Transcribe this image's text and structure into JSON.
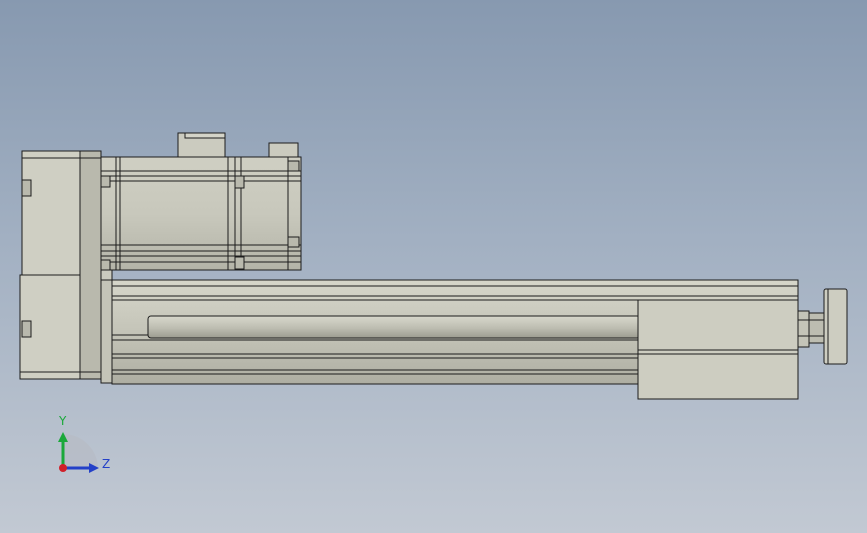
{
  "viewport": {
    "background_top": "#8799b0",
    "background_bottom": "#c2c9d3",
    "part_fill": "#cbcbbf",
    "part_shade": "#a6a69a",
    "edge_color": "#1c1c1c"
  },
  "triad": {
    "y_label": "Y",
    "z_label": "Z",
    "y_color": "#1aa83a",
    "z_color": "#2340c8",
    "x_color": "#d0202a"
  },
  "icons": {
    "model": "linear-actuator-model",
    "triad": "axis-triad-icon"
  }
}
